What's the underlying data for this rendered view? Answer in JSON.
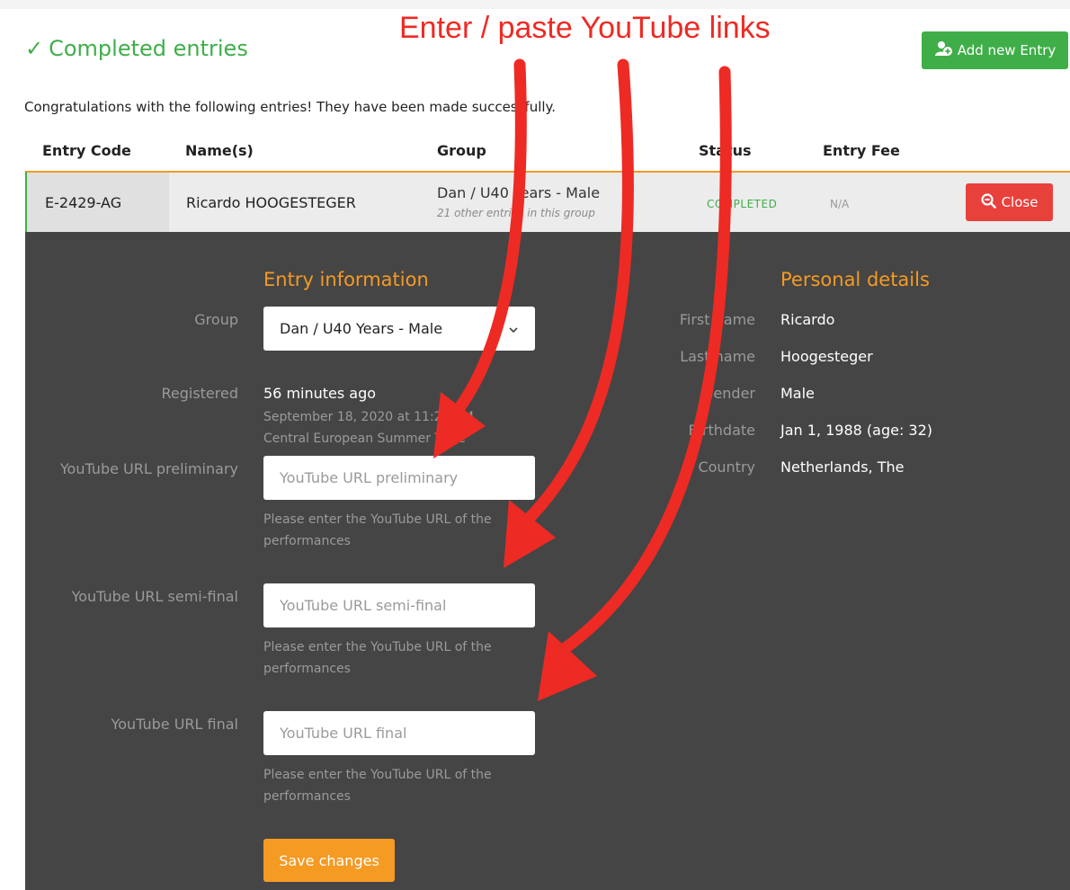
{
  "header": {
    "title": "Completed entries",
    "add_button_label": "Add new Entry"
  },
  "intro_text": "Congratulations with the following entries! They have been made successfully.",
  "table": {
    "columns": [
      "Entry Code",
      "Name(s)",
      "Group",
      "Status",
      "Entry Fee"
    ]
  },
  "entry": {
    "code": "E-2429-AG",
    "name": "Ricardo HOOGESTEGER",
    "group": "Dan / U40 Years - Male",
    "group_note": "21 other entries in this group",
    "status": "COMPLETED",
    "fee": "N/A",
    "close_label": "Close"
  },
  "details": {
    "entry_info_title": "Entry information",
    "group_label": "Group",
    "group_value": "Dan / U40 Years - Male",
    "registered_label": "Registered",
    "registered_relative": "56 minutes ago",
    "registered_date": "September 18, 2020 at 11:29 AM",
    "registered_tz": "Central European Summer Time",
    "fields": [
      {
        "label": "YouTube URL preliminary",
        "placeholder": "YouTube URL preliminary",
        "value": "",
        "help_line1": "Please enter the YouTube URL of the",
        "help_line2": "performances"
      },
      {
        "label": "YouTube URL semi-final",
        "placeholder": "YouTube URL semi-final",
        "value": "",
        "help_line1": "Please enter the YouTube URL of the",
        "help_line2": "performances"
      },
      {
        "label": "YouTube URL final",
        "placeholder": "YouTube URL final",
        "value": "",
        "help_line1": "Please enter the YouTube URL of the",
        "help_line2": "performances"
      }
    ],
    "save_label": "Save changes"
  },
  "personal": {
    "title": "Personal details",
    "rows": [
      {
        "label": "First name",
        "value": "Ricardo"
      },
      {
        "label": "Last name",
        "value": "Hoogesteger"
      },
      {
        "label": "Gender",
        "value": "Male"
      },
      {
        "label": "Birthdate",
        "value": "Jan 1, 1988 (age: 32)"
      },
      {
        "label": "Country",
        "value": "Netherlands, The"
      }
    ]
  },
  "annotation": {
    "text": "Enter / paste YouTube links",
    "color": "#ee2a24"
  },
  "colors": {
    "success": "#3fae49",
    "accent": "#f59a23",
    "danger": "#e8413c",
    "panel": "#454545"
  },
  "icons": {
    "heading": "check-icon",
    "add": "add-user-icon",
    "close": "zoom-out-icon",
    "select": "chevron-down-icon"
  }
}
